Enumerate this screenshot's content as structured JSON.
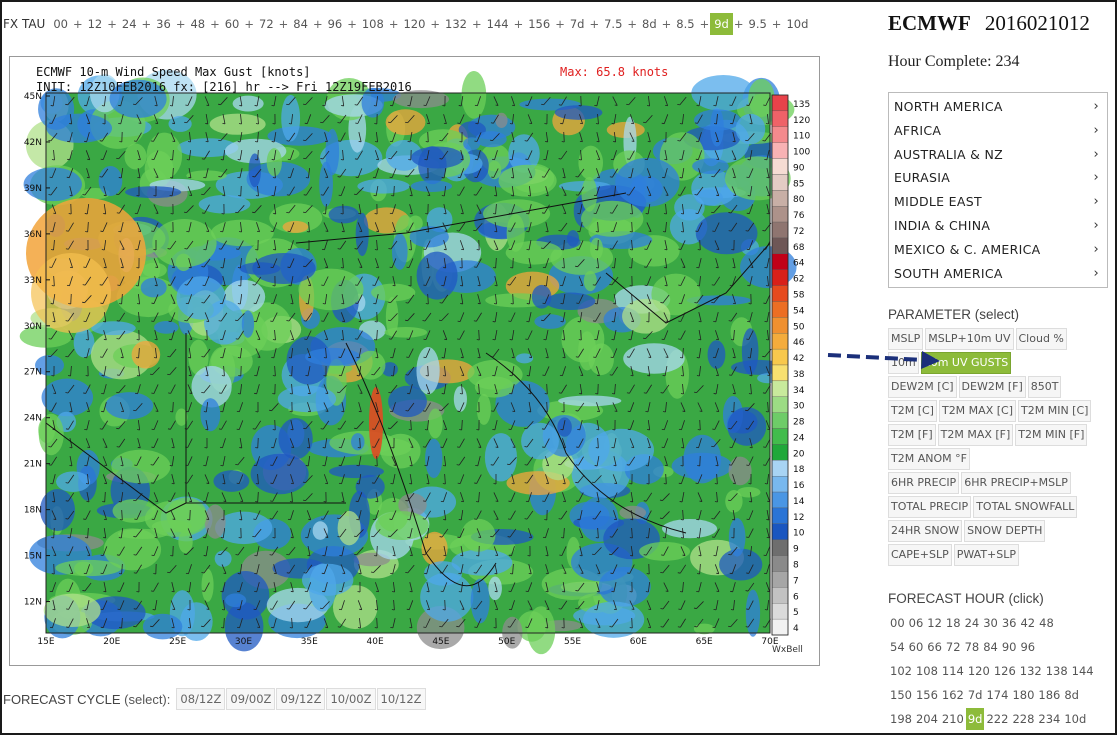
{
  "fx_tau": {
    "label": "FX TAU",
    "steps": [
      "00",
      "12",
      "24",
      "36",
      "48",
      "60",
      "72",
      "84",
      "96",
      "108",
      "120",
      "132",
      "144",
      "156",
      "7d",
      "7.5",
      "8d",
      "8.5",
      "9d",
      "9.5",
      "10d"
    ],
    "separator": "+",
    "active": "9d"
  },
  "map": {
    "title": "ECMWF 10-m Wind Speed Max Gust [knots]",
    "init_line": "INIT: 12Z10FEB2016 fx: [216] hr --> Fri 12Z19FEB2016",
    "max_text": "Max: 65.8 knots",
    "credit": "WxBell",
    "lat_labels": [
      "45N",
      "42N",
      "39N",
      "36N",
      "33N",
      "30N",
      "27N",
      "24N",
      "21N",
      "18N",
      "15N",
      "12N"
    ],
    "lon_labels": [
      "15E",
      "20E",
      "25E",
      "30E",
      "35E",
      "40E",
      "45E",
      "50E",
      "55E",
      "60E",
      "65E",
      "70E"
    ],
    "colorbar_labels": [
      "135",
      "120",
      "110",
      "100",
      "90",
      "85",
      "80",
      "76",
      "72",
      "68",
      "64",
      "62",
      "58",
      "54",
      "50",
      "46",
      "42",
      "38",
      "34",
      "30",
      "28",
      "24",
      "20",
      "18",
      "16",
      "14",
      "12",
      "10",
      "9",
      "8",
      "7",
      "6",
      "5",
      "4"
    ],
    "colorbar_colors": [
      "#e8424a",
      "#ef6268",
      "#f48a8d",
      "#f8b2b4",
      "#f6dcd3",
      "#e3ccc4",
      "#c8afa6",
      "#ad928a",
      "#8f7570",
      "#6e5756",
      "#c00018",
      "#d8201a",
      "#e64a1e",
      "#ec6e24",
      "#f09030",
      "#f4ac3c",
      "#f8c84c",
      "#f8e070",
      "#c8ea9c",
      "#9cdc84",
      "#6ecc68",
      "#42bc4c",
      "#20a83a",
      "#a8d4f4",
      "#78b8ee",
      "#4a96e4",
      "#2a74d6",
      "#1a56c0",
      "#6e6e6e",
      "#8a8a8a",
      "#a6a6a6",
      "#c2c2c2",
      "#dadada",
      "#f2f2f2"
    ]
  },
  "forecast_cycle": {
    "label": "FORECAST CYCLE",
    "label_suffix": "(select):",
    "cycles": [
      "08/12Z",
      "09/00Z",
      "09/12Z",
      "10/00Z",
      "10/12Z"
    ]
  },
  "header": {
    "model": "ECMWF",
    "run": "2016021012",
    "hour_complete": "Hour Complete: 234"
  },
  "regions": [
    "NORTH AMERICA",
    "AFRICA",
    "AUSTRALIA & NZ",
    "EURASIA",
    "MIDDLE EAST",
    "INDIA & CHINA",
    "MEXICO & C. AMERICA",
    "SOUTH AMERICA"
  ],
  "parameter": {
    "title": "PARAMETER",
    "title_suffix": "(select)",
    "rows": [
      [
        "MSLP",
        "MSLP+10m UV",
        "Cloud %"
      ],
      [
        "10m",
        "10m UV GUSTS"
      ],
      [
        "DEW2M [C]",
        "DEW2M [F]",
        "850T"
      ],
      [
        "T2M [C]",
        "T2M MAX [C]",
        "T2M MIN [C]"
      ],
      [
        "T2M [F]",
        "T2M MAX [F]",
        "T2M MIN [F]"
      ],
      [
        "T2M ANOM °F"
      ],
      [
        "6HR PRECIP",
        "6HR PRECIP+MSLP"
      ],
      [
        "TOTAL PRECIP",
        "TOTAL SNOWFALL"
      ],
      [
        "24HR SNOW",
        "SNOW DEPTH"
      ],
      [
        "CAPE+SLP",
        "PWAT+SLP"
      ]
    ],
    "active": "10m UV GUSTS"
  },
  "forecast_hour": {
    "title": "FORECAST HOUR",
    "title_suffix": "(click)",
    "rows": [
      [
        "00",
        "06",
        "12",
        "18",
        "24",
        "30",
        "36",
        "42",
        "48"
      ],
      [
        "54",
        "60",
        "66",
        "72",
        "78",
        "84",
        "90",
        "96"
      ],
      [
        "102",
        "108",
        "114",
        "120",
        "126",
        "132",
        "138",
        "144"
      ],
      [
        "150",
        "156",
        "162",
        "7d",
        "174",
        "180",
        "186",
        "8d"
      ],
      [
        "198",
        "204",
        "210",
        "9d",
        "222",
        "228",
        "234",
        "10d"
      ]
    ],
    "active": "9d"
  },
  "colors": {
    "active_green": "#8dbb3a",
    "max_red": "#e02020",
    "arrow_navy": "#1b2f7a"
  }
}
